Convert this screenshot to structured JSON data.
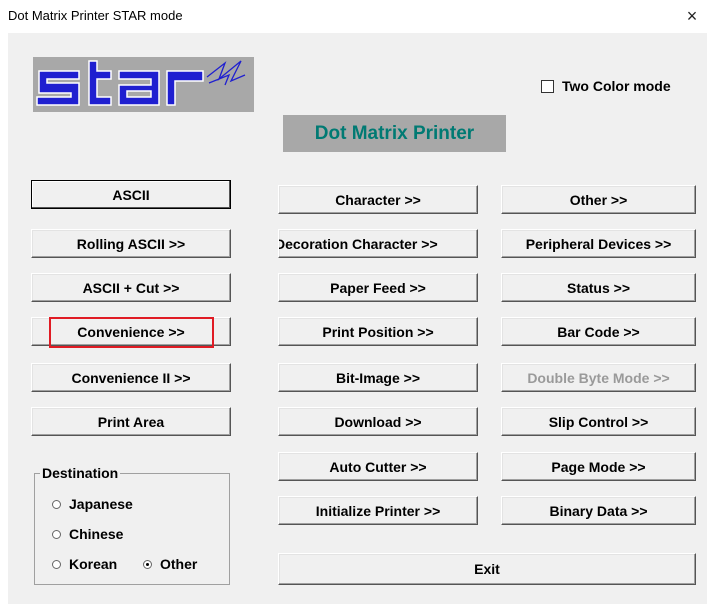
{
  "window": {
    "title": "Dot Matrix Printer  STAR mode",
    "close_glyph": "×"
  },
  "logo": {
    "text": "star",
    "icon": "star-logo"
  },
  "header": {
    "title": "Dot Matrix Printer"
  },
  "options": {
    "two_color_label": "Two Color mode",
    "two_color_checked": false
  },
  "buttons": {
    "ascii": "ASCII",
    "rolling_ascii": "Rolling ASCII  >>",
    "ascii_cut": "ASCII + Cut  >>",
    "convenience": "Convenience  >>",
    "convenience_ii": "Convenience II  >>",
    "print_area": "Print Area",
    "character": "Character  >>",
    "decoration_character": "Decoration Character  >>",
    "paper_feed": "Paper Feed  >>",
    "print_position": "Print Position  >>",
    "bit_image": "Bit-Image  >>",
    "download": "Download  >>",
    "auto_cutter": "Auto Cutter  >>",
    "initialize_printer": "Initialize Printer  >>",
    "other": "Other  >>",
    "peripheral_devices": "Peripheral Devices  >>",
    "status": "Status  >>",
    "bar_code": "Bar Code  >>",
    "double_byte_mode": "Double Byte Mode  >>",
    "slip_control": "Slip Control  >>",
    "page_mode": "Page Mode  >>",
    "binary_data": "Binary Data  >>",
    "exit": "Exit"
  },
  "destination": {
    "label": "Destination",
    "selected": "Other",
    "japanese": "Japanese",
    "chinese": "Chinese",
    "korean": "Korean",
    "other": "Other"
  },
  "colors": {
    "accent_teal": "#007a73",
    "highlight_red": "#e01b24",
    "logo_blue": "#1f1fd0"
  }
}
